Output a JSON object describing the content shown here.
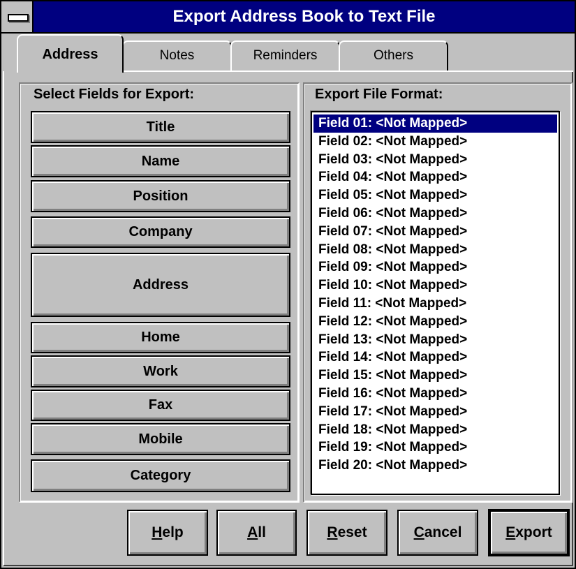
{
  "window": {
    "title": "Export Address Book to Text File"
  },
  "tabs": [
    {
      "label": "Address",
      "active": true
    },
    {
      "label": "Notes",
      "active": false
    },
    {
      "label": "Reminders",
      "active": false
    },
    {
      "label": "Others",
      "active": false
    }
  ],
  "fields_group": {
    "title": "Select Fields for Export:",
    "buttons": [
      "Title",
      "Name",
      "Position",
      "Company",
      "Address",
      "Home",
      "Work",
      "Fax",
      "Mobile",
      "Category"
    ]
  },
  "format_group": {
    "title": "Export File Format:",
    "selected_index": 0,
    "items": [
      "Field 01: <Not Mapped>",
      "Field 02: <Not Mapped>",
      "Field 03: <Not Mapped>",
      "Field 04: <Not Mapped>",
      "Field 05: <Not Mapped>",
      "Field 06: <Not Mapped>",
      "Field 07: <Not Mapped>",
      "Field 08: <Not Mapped>",
      "Field 09: <Not Mapped>",
      "Field 10: <Not Mapped>",
      "Field 11: <Not Mapped>",
      "Field 12: <Not Mapped>",
      "Field 13: <Not Mapped>",
      "Field 14: <Not Mapped>",
      "Field 15: <Not Mapped>",
      "Field 16: <Not Mapped>",
      "Field 17: <Not Mapped>",
      "Field 18: <Not Mapped>",
      "Field 19: <Not Mapped>",
      "Field 20: <Not Mapped>"
    ]
  },
  "actions": {
    "help": {
      "mnemonic": "H",
      "rest": "elp"
    },
    "all": {
      "mnemonic": "A",
      "rest": "ll"
    },
    "reset": {
      "mnemonic": "R",
      "rest": "eset"
    },
    "cancel": {
      "mnemonic": "C",
      "rest": "ancel"
    },
    "export": {
      "mnemonic": "E",
      "rest": "xport"
    }
  },
  "colors": {
    "face": "#c0c0c0",
    "titlebar": "#000080",
    "selection": "#000080"
  }
}
